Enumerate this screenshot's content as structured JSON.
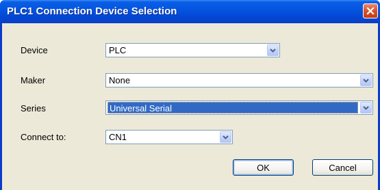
{
  "window": {
    "title": "PLC1 Connection Device Selection"
  },
  "fields": {
    "device": {
      "label": "Device",
      "value": "PLC"
    },
    "maker": {
      "label": "Maker",
      "value": "None"
    },
    "series": {
      "label": "Series",
      "value": "Universal Serial"
    },
    "connect_to": {
      "label": "Connect to:",
      "value": "CN1"
    }
  },
  "buttons": {
    "ok": "OK",
    "cancel": "Cancel"
  },
  "icons": {
    "close": "close-icon",
    "dropdown": "chevron-down-icon"
  },
  "colors": {
    "titlebar": "#0555e0",
    "client_bg": "#ece9d8",
    "selection": "#316ac5",
    "close_btn": "#d9562f"
  }
}
